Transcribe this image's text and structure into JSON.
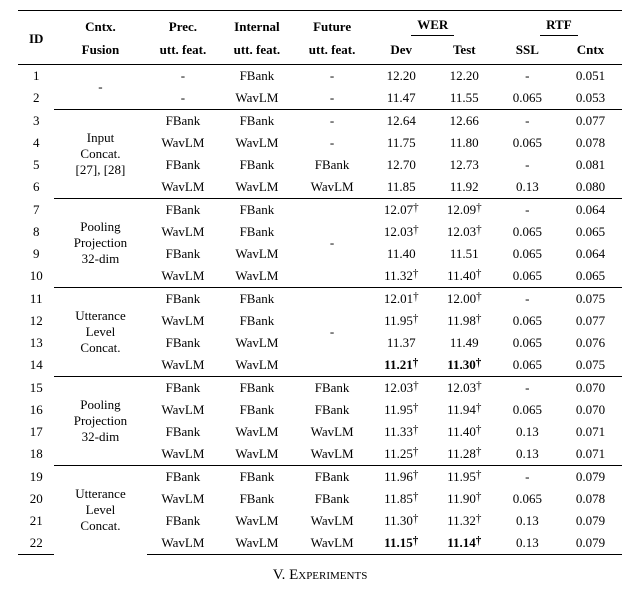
{
  "headers": {
    "id": "ID",
    "cntx1": "Cntx.",
    "cntx2": "Fusion",
    "prec1": "Prec.",
    "prec2": "utt. feat.",
    "int1": "Internal",
    "int2": "utt. feat.",
    "fut1": "Future",
    "fut2": "utt. feat.",
    "wer": "WER",
    "dev": "Dev",
    "test": "Test",
    "rtf": "RTF",
    "ssl": "SSL",
    "cntx": "Cntx"
  },
  "fusion_labels": {
    "g1": "-",
    "g2a": "Input",
    "g2b": "Concat.",
    "g2c": "[27], [28]",
    "g3a": "Pooling",
    "g3b": "Projection",
    "g3c": "32-dim",
    "g4a": "Utterance",
    "g4b": "Level",
    "g4c": "Concat.",
    "g5a": "Pooling",
    "g5b": "Projection",
    "g5c": "32-dim",
    "g6a": "Utterance",
    "g6b": "Level",
    "g6c": "Concat."
  },
  "feat": {
    "fbank": "FBank",
    "wavlm": "WavLM",
    "dash": "-"
  },
  "rows": [
    {
      "id": "1",
      "prec": "-",
      "intl": "FBank",
      "fut": "-",
      "dev": "12.20",
      "devd": false,
      "test": "12.20",
      "testd": false,
      "ssl": "-",
      "cntx": "0.051",
      "bold": false
    },
    {
      "id": "2",
      "prec": "-",
      "intl": "WavLM",
      "fut": "-",
      "dev": "11.47",
      "devd": false,
      "test": "11.55",
      "testd": false,
      "ssl": "0.065",
      "cntx": "0.053",
      "bold": false
    },
    {
      "id": "3",
      "prec": "FBank",
      "intl": "FBank",
      "fut": "-",
      "dev": "12.64",
      "devd": false,
      "test": "12.66",
      "testd": false,
      "ssl": "-",
      "cntx": "0.077",
      "bold": false
    },
    {
      "id": "4",
      "prec": "WavLM",
      "intl": "WavLM",
      "fut": "-",
      "dev": "11.75",
      "devd": false,
      "test": "11.80",
      "testd": false,
      "ssl": "0.065",
      "cntx": "0.078",
      "bold": false
    },
    {
      "id": "5",
      "prec": "FBank",
      "intl": "FBank",
      "fut": "FBank",
      "dev": "12.70",
      "devd": false,
      "test": "12.73",
      "testd": false,
      "ssl": "-",
      "cntx": "0.081",
      "bold": false
    },
    {
      "id": "6",
      "prec": "WavLM",
      "intl": "WavLM",
      "fut": "WavLM",
      "dev": "11.85",
      "devd": false,
      "test": "11.92",
      "testd": false,
      "ssl": "0.13",
      "cntx": "0.080",
      "bold": false
    },
    {
      "id": "7",
      "prec": "FBank",
      "intl": "FBank",
      "fut": "",
      "dev": "12.07",
      "devd": true,
      "test": "12.09",
      "testd": true,
      "ssl": "-",
      "cntx": "0.064",
      "bold": false
    },
    {
      "id": "8",
      "prec": "WavLM",
      "intl": "FBank",
      "fut": "",
      "dev": "12.03",
      "devd": true,
      "test": "12.03",
      "testd": true,
      "ssl": "0.065",
      "cntx": "0.065",
      "bold": false
    },
    {
      "id": "9",
      "prec": "FBank",
      "intl": "WavLM",
      "fut": "",
      "dev": "11.40",
      "devd": false,
      "test": "11.51",
      "testd": false,
      "ssl": "0.065",
      "cntx": "0.064",
      "bold": false
    },
    {
      "id": "10",
      "prec": "WavLM",
      "intl": "WavLM",
      "fut": "",
      "dev": "11.32",
      "devd": true,
      "test": "11.40",
      "testd": true,
      "ssl": "0.065",
      "cntx": "0.065",
      "bold": false
    },
    {
      "id": "11",
      "prec": "FBank",
      "intl": "FBank",
      "fut": "",
      "dev": "12.01",
      "devd": true,
      "test": "12.00",
      "testd": true,
      "ssl": "-",
      "cntx": "0.075",
      "bold": false
    },
    {
      "id": "12",
      "prec": "WavLM",
      "intl": "FBank",
      "fut": "",
      "dev": "11.95",
      "devd": true,
      "test": "11.98",
      "testd": true,
      "ssl": "0.065",
      "cntx": "0.077",
      "bold": false
    },
    {
      "id": "13",
      "prec": "FBank",
      "intl": "WavLM",
      "fut": "",
      "dev": "11.37",
      "devd": false,
      "test": "11.49",
      "testd": false,
      "ssl": "0.065",
      "cntx": "0.076",
      "bold": false
    },
    {
      "id": "14",
      "prec": "WavLM",
      "intl": "WavLM",
      "fut": "",
      "dev": "11.21",
      "devd": true,
      "test": "11.30",
      "testd": true,
      "ssl": "0.065",
      "cntx": "0.075",
      "bold": true
    },
    {
      "id": "15",
      "prec": "FBank",
      "intl": "FBank",
      "fut": "FBank",
      "dev": "12.03",
      "devd": true,
      "test": "12.03",
      "testd": true,
      "ssl": "-",
      "cntx": "0.070",
      "bold": false
    },
    {
      "id": "16",
      "prec": "WavLM",
      "intl": "FBank",
      "fut": "FBank",
      "dev": "11.95",
      "devd": true,
      "test": "11.94",
      "testd": true,
      "ssl": "0.065",
      "cntx": "0.070",
      "bold": false
    },
    {
      "id": "17",
      "prec": "FBank",
      "intl": "WavLM",
      "fut": "WavLM",
      "dev": "11.33",
      "devd": true,
      "test": "11.40",
      "testd": true,
      "ssl": "0.13",
      "cntx": "0.071",
      "bold": false
    },
    {
      "id": "18",
      "prec": "WavLM",
      "intl": "WavLM",
      "fut": "WavLM",
      "dev": "11.25",
      "devd": true,
      "test": "11.28",
      "testd": true,
      "ssl": "0.13",
      "cntx": "0.071",
      "bold": false
    },
    {
      "id": "19",
      "prec": "FBank",
      "intl": "FBank",
      "fut": "FBank",
      "dev": "11.96",
      "devd": true,
      "test": "11.95",
      "testd": true,
      "ssl": "-",
      "cntx": "0.079",
      "bold": false
    },
    {
      "id": "20",
      "prec": "WavLM",
      "intl": "FBank",
      "fut": "FBank",
      "dev": "11.85",
      "devd": true,
      "test": "11.90",
      "testd": true,
      "ssl": "0.065",
      "cntx": "0.078",
      "bold": false
    },
    {
      "id": "21",
      "prec": "FBank",
      "intl": "WavLM",
      "fut": "WavLM",
      "dev": "11.30",
      "devd": true,
      "test": "11.32",
      "testd": true,
      "ssl": "0.13",
      "cntx": "0.079",
      "bold": false
    },
    {
      "id": "22",
      "prec": "WavLM",
      "intl": "WavLM",
      "fut": "WavLM",
      "dev": "11.15",
      "devd": true,
      "test": "11.14",
      "testd": true,
      "ssl": "0.13",
      "cntx": "0.079",
      "bold": true
    }
  ],
  "groups": {
    "g3_fut": "-",
    "g4_fut": "-"
  },
  "section_title": "V.  Experiments"
}
